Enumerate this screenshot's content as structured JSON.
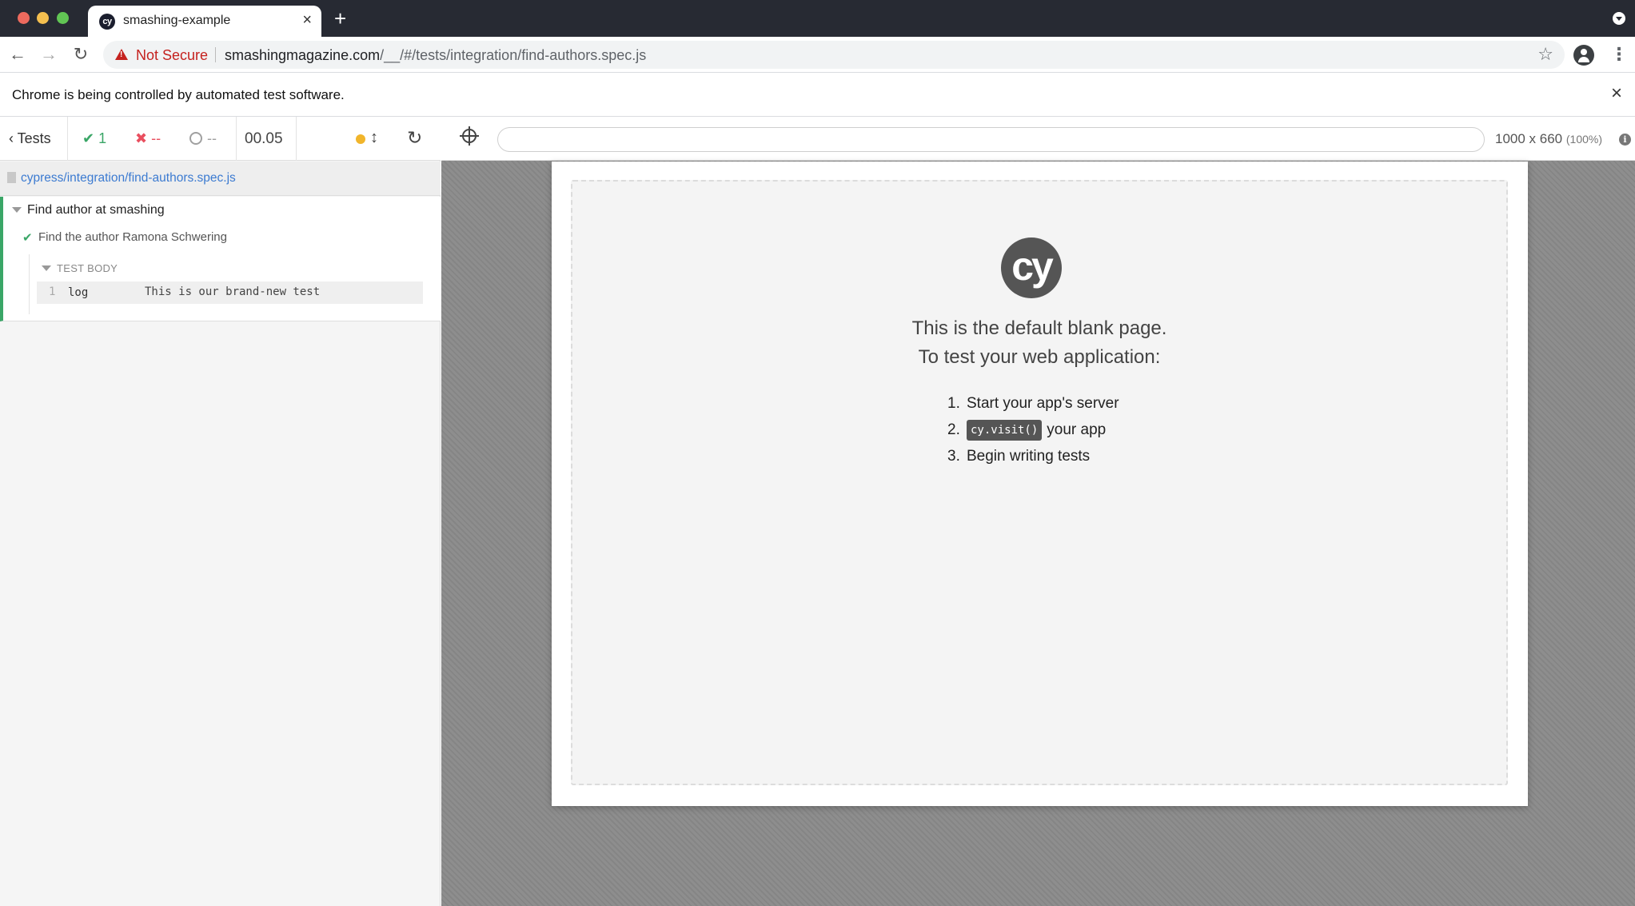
{
  "browser": {
    "tab_title": "smashing-example",
    "tab_favicon_text": "cy",
    "new_tab_glyph": "+",
    "security_label": "Not Secure",
    "url_host": "smashingmagazine.com",
    "url_path": "/__/#/tests/integration/find-authors.spec.js",
    "infobar_text": "Chrome is being controlled by automated test software."
  },
  "reporter": {
    "tests_label": "Tests",
    "passed": "1",
    "failed": "--",
    "pending": "--",
    "duration": "00.05",
    "spec_path": "cypress/integration/find-authors.spec.js",
    "suite": {
      "title": "Find author at smashing",
      "test": {
        "title": "Find the author Ramona Schwering",
        "body_label": "TEST BODY",
        "commands": [
          {
            "num": "1",
            "name": "log",
            "message": "This is our brand-new test"
          }
        ]
      }
    }
  },
  "aut": {
    "url_value": "",
    "viewport_size": "1000 x 660",
    "viewport_scale": "(100%)",
    "blank_page": {
      "logo_text": "cy",
      "line1": "This is the default blank page.",
      "line2": "To test your web application:",
      "steps": [
        {
          "num": "1.",
          "code": "",
          "text": "Start your app's server"
        },
        {
          "num": "2.",
          "code": "cy.visit()",
          "text": "your app"
        },
        {
          "num": "3.",
          "code": "",
          "text": "Begin writing tests"
        }
      ]
    }
  },
  "colors": {
    "pass": "#3aa667",
    "fail": "#e94f5f",
    "link": "#3c7bd1",
    "not_secure": "#c5221f",
    "running_dot": "#f1b52b"
  },
  "icons": [
    "back-arrow-icon",
    "forward-arrow-icon",
    "reload-icon",
    "warning-icon",
    "star-icon",
    "profile-icon",
    "kebab-menu-icon",
    "close-icon",
    "chevron-left-icon",
    "check-icon",
    "x-icon",
    "pending-circle-icon",
    "resize-arrows-icon",
    "restart-icon",
    "crosshair-icon",
    "file-icon",
    "caret-down-icon",
    "info-icon"
  ]
}
